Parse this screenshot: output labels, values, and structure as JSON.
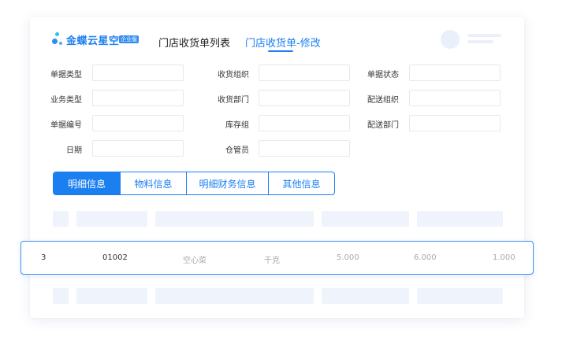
{
  "brand": {
    "name": "金蝶云星空",
    "badge": "企业版"
  },
  "nav": {
    "tab_list": "门店收货单列表",
    "tab_edit": "门店收货单-修改"
  },
  "form": {
    "doc_type": "单据类型",
    "receive_org": "收货组织",
    "doc_status": "单据状态",
    "biz_type": "业务类型",
    "receive_dept": "收货部门",
    "delivery_org": "配送组织",
    "doc_no": "单据编号",
    "stock_group": "库存组",
    "delivery_dept": "配送部门",
    "date": "日期",
    "warehouse_keeper": "仓管员"
  },
  "tabs": [
    "明细信息",
    "物料信息",
    "明细财务信息",
    "其他信息"
  ],
  "row": [
    "3",
    "01002",
    "空心菜",
    "千克",
    "5.000",
    "6.000",
    "1.000"
  ],
  "colors": {
    "accent": "#1b7ff0",
    "placeholder": "#eef3fc"
  }
}
